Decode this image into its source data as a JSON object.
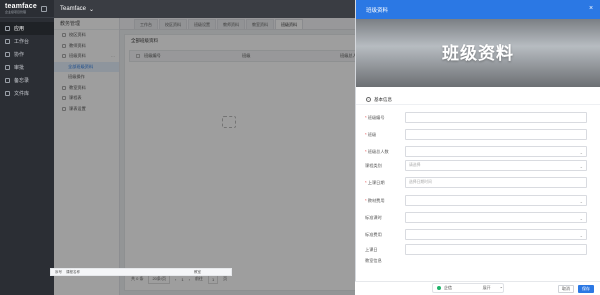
{
  "app": {
    "logo": "teamface",
    "logo_sub": "企业级项目管理",
    "workspace": "Teamface"
  },
  "nav": [
    {
      "label": "应用",
      "icon": "apps-icon"
    },
    {
      "label": "工作台",
      "icon": "desk-icon"
    },
    {
      "label": "协作",
      "icon": "collab-icon"
    },
    {
      "label": "审批",
      "icon": "approve-icon"
    },
    {
      "label": "备忘录",
      "icon": "memo-icon"
    },
    {
      "label": "文件库",
      "icon": "files-icon"
    }
  ],
  "module": {
    "title": "教务管理",
    "items": [
      {
        "label": "校区资料"
      },
      {
        "label": "教师资料"
      },
      {
        "label": "班级资料"
      },
      {
        "label": "全部班级资料"
      },
      {
        "label": "班级操作"
      },
      {
        "label": "教室资料"
      },
      {
        "label": "课程表"
      },
      {
        "label": "课表设置"
      }
    ]
  },
  "tabs": [
    "工作台",
    "校区资料",
    "班级设置",
    "教师资料",
    "教室资料",
    "班级资料"
  ],
  "list": {
    "title": "全部班级资料",
    "columns": [
      "班级编号",
      "班级",
      "班级总人数"
    ],
    "pager": {
      "total": "共 0 条",
      "size": "20条/页",
      "page": "1",
      "jump_label": "前往",
      "page_num": "1",
      "unit": "页"
    }
  },
  "drawer": {
    "title": "班级资料",
    "banner": "班级资料",
    "section": "基本信息",
    "fields": [
      {
        "label": "班级编号",
        "required": true,
        "placeholder": "",
        "select": false
      },
      {
        "label": "班级",
        "required": true,
        "placeholder": "",
        "select": false
      },
      {
        "label": "班级总人数",
        "required": true,
        "placeholder": "",
        "select": true
      },
      {
        "label": "课程类别",
        "required": false,
        "placeholder": "请选择",
        "select": true
      },
      {
        "label": "上课日期",
        "required": true,
        "placeholder": "选择日期时间",
        "select": false
      },
      {
        "label": "教材费用",
        "required": true,
        "placeholder": "",
        "select": true
      },
      {
        "label": "标准课时",
        "required": false,
        "placeholder": "",
        "select": true
      },
      {
        "label": "标准费用",
        "required": false,
        "placeholder": "",
        "select": true
      },
      {
        "label": "上课日",
        "required": false,
        "placeholder": "",
        "select": false
      }
    ],
    "subtable_label": "教室信息",
    "subtable_cols": [
      "序号",
      "课程名称",
      "教室"
    ],
    "cancel": "取消",
    "save": "保存"
  },
  "chat": {
    "name": "企信",
    "status": "展开"
  }
}
